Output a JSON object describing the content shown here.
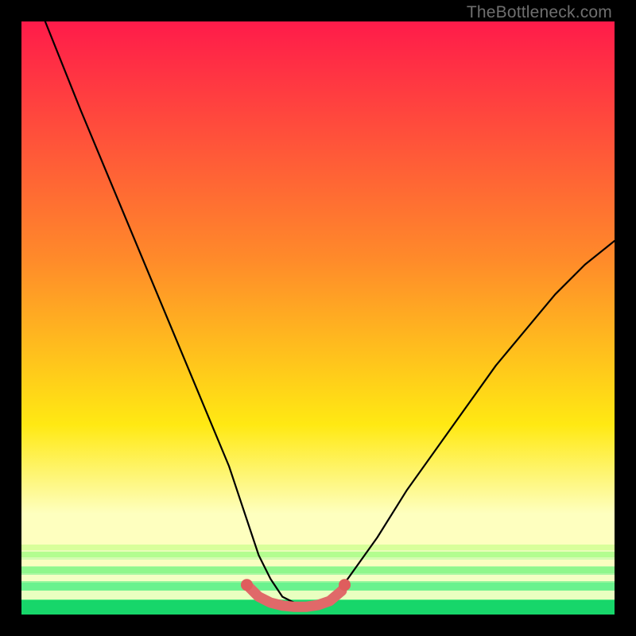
{
  "watermark": {
    "text": "TheBottleneck.com"
  },
  "colors": {
    "top": "#ff1b4a",
    "mid1": "#ff8a2a",
    "mid2": "#ffe913",
    "pale": "#feffbf",
    "green_light": "#6af28e",
    "green": "#17d66a",
    "green_deep": "#0fbf5c",
    "curve": "#000000",
    "accent": "#e06969",
    "accent_dot": "#df5d5d"
  },
  "chart_data": {
    "type": "line",
    "title": "",
    "xlabel": "",
    "ylabel": "",
    "xlim": [
      0,
      100
    ],
    "ylim": [
      0,
      100
    ],
    "series": [
      {
        "name": "bottleneck-curve",
        "x": [
          4,
          10,
          15,
          20,
          25,
          30,
          35,
          38,
          40,
          42,
          44,
          46,
          48,
          50,
          52,
          55,
          60,
          65,
          70,
          75,
          80,
          85,
          90,
          95,
          100
        ],
        "values": [
          100,
          85,
          73,
          61,
          49,
          37,
          25,
          16,
          10,
          6,
          3,
          2,
          2,
          2,
          3,
          6,
          13,
          21,
          28,
          35,
          42,
          48,
          54,
          59,
          63
        ]
      }
    ],
    "accent_segment": {
      "name": "near-zero-bottleneck",
      "x": [
        38,
        40,
        42,
        44,
        46,
        48,
        50,
        52,
        54
      ],
      "values": [
        5,
        3,
        2,
        1.5,
        1.3,
        1.3,
        1.6,
        2.3,
        4
      ]
    },
    "accent_start_dot": {
      "x": 38,
      "y": 5
    },
    "accent_end_dot": {
      "x": 54.5,
      "y": 5
    }
  }
}
